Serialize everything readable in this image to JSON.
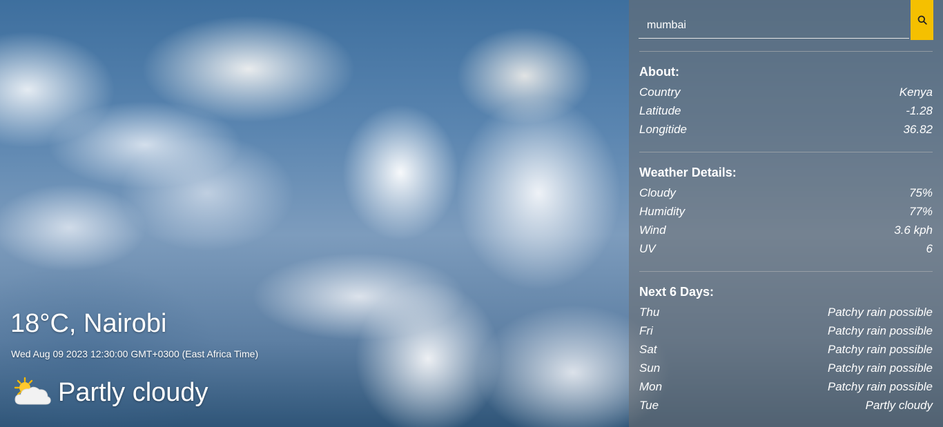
{
  "current": {
    "temp_city": "18°C, Nairobi",
    "datetime": "Wed Aug 09 2023 12:30:00 GMT+0300 (East Africa Time)",
    "condition": "Partly cloudy",
    "condition_icon": "partly-cloudy-icon"
  },
  "search": {
    "value": "mumbai",
    "button_icon": "search-icon",
    "button_color": "#f5c000"
  },
  "about": {
    "title": "About:",
    "rows": [
      {
        "label": "Country",
        "value": "Kenya"
      },
      {
        "label": "Latitude",
        "value": "-1.28"
      },
      {
        "label": "Longitide",
        "value": "36.82"
      }
    ]
  },
  "weather_details": {
    "title": "Weather Details:",
    "rows": [
      {
        "label": "Cloudy",
        "value": "75%"
      },
      {
        "label": "Humidity",
        "value": "77%"
      },
      {
        "label": "Wind",
        "value": "3.6 kph"
      },
      {
        "label": "UV",
        "value": "6"
      }
    ]
  },
  "forecast": {
    "title": "Next 6 Days:",
    "rows": [
      {
        "label": "Thu",
        "value": "Patchy rain possible"
      },
      {
        "label": "Fri",
        "value": "Patchy rain possible"
      },
      {
        "label": "Sat",
        "value": "Patchy rain possible"
      },
      {
        "label": "Sun",
        "value": "Patchy rain possible"
      },
      {
        "label": "Mon",
        "value": "Patchy rain possible"
      },
      {
        "label": "Tue",
        "value": "Partly cloudy"
      }
    ]
  }
}
